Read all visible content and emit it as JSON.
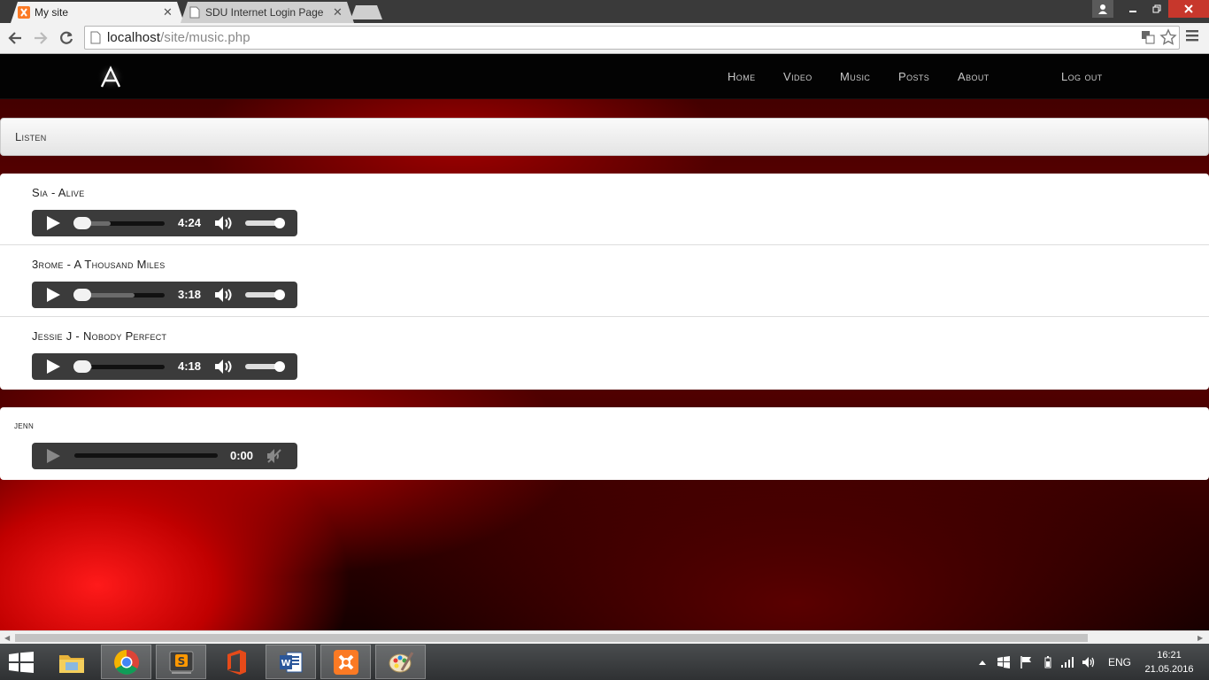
{
  "browser": {
    "tabs": [
      {
        "title": "My site",
        "active": true
      },
      {
        "title": "SDU Internet Login Page",
        "active": false
      }
    ],
    "url_host": "localhost",
    "url_path": "/site/music.php"
  },
  "site": {
    "nav": {
      "home": "Home",
      "video": "Video",
      "music": "Music",
      "posts": "Posts",
      "about": "About",
      "logout": "Log out"
    },
    "section_heading": "Listen",
    "tracks": [
      {
        "title": "Sia - Alive",
        "duration": "4:24",
        "buffered": 0.4
      },
      {
        "title": "3rome - A Thousand Miles",
        "duration": "3:18",
        "buffered": 0.67
      },
      {
        "title": "Jessie J - Nobody Perfect",
        "duration": "4:18",
        "buffered": 0.2
      }
    ],
    "upload": {
      "label": "jenn",
      "duration": "0:00"
    }
  },
  "taskbar": {
    "language": "ENG",
    "time": "16:21",
    "date": "21.05.2016"
  },
  "colors": {
    "navbar": "#030303",
    "player": "#3b3b3b",
    "accent_red": "#c00000"
  }
}
